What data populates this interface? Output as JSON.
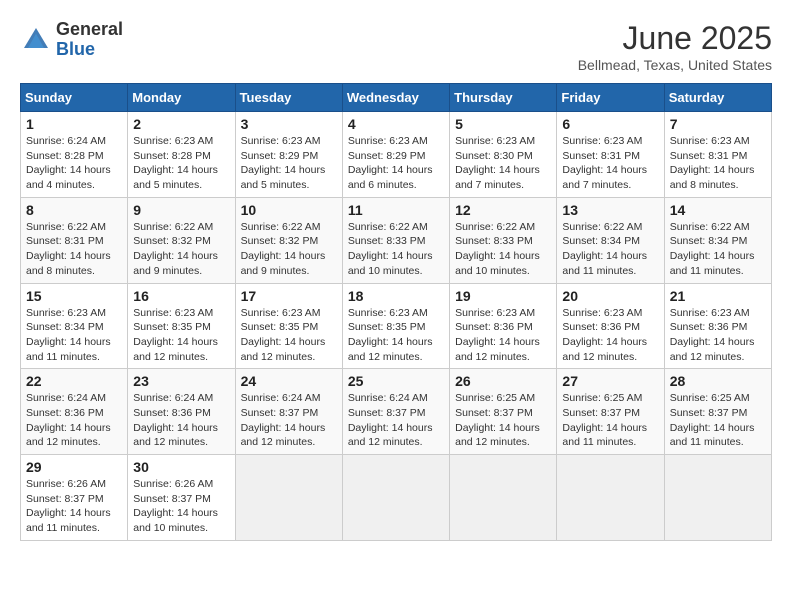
{
  "logo": {
    "general": "General",
    "blue": "Blue"
  },
  "title": "June 2025",
  "location": "Bellmead, Texas, United States",
  "days_of_week": [
    "Sunday",
    "Monday",
    "Tuesday",
    "Wednesday",
    "Thursday",
    "Friday",
    "Saturday"
  ],
  "weeks": [
    [
      {
        "day": "1",
        "sunrise": "6:24 AM",
        "sunset": "8:28 PM",
        "daylight": "14 hours and 4 minutes."
      },
      {
        "day": "2",
        "sunrise": "6:23 AM",
        "sunset": "8:28 PM",
        "daylight": "14 hours and 5 minutes."
      },
      {
        "day": "3",
        "sunrise": "6:23 AM",
        "sunset": "8:29 PM",
        "daylight": "14 hours and 5 minutes."
      },
      {
        "day": "4",
        "sunrise": "6:23 AM",
        "sunset": "8:29 PM",
        "daylight": "14 hours and 6 minutes."
      },
      {
        "day": "5",
        "sunrise": "6:23 AM",
        "sunset": "8:30 PM",
        "daylight": "14 hours and 7 minutes."
      },
      {
        "day": "6",
        "sunrise": "6:23 AM",
        "sunset": "8:31 PM",
        "daylight": "14 hours and 7 minutes."
      },
      {
        "day": "7",
        "sunrise": "6:23 AM",
        "sunset": "8:31 PM",
        "daylight": "14 hours and 8 minutes."
      }
    ],
    [
      {
        "day": "8",
        "sunrise": "6:22 AM",
        "sunset": "8:31 PM",
        "daylight": "14 hours and 8 minutes."
      },
      {
        "day": "9",
        "sunrise": "6:22 AM",
        "sunset": "8:32 PM",
        "daylight": "14 hours and 9 minutes."
      },
      {
        "day": "10",
        "sunrise": "6:22 AM",
        "sunset": "8:32 PM",
        "daylight": "14 hours and 9 minutes."
      },
      {
        "day": "11",
        "sunrise": "6:22 AM",
        "sunset": "8:33 PM",
        "daylight": "14 hours and 10 minutes."
      },
      {
        "day": "12",
        "sunrise": "6:22 AM",
        "sunset": "8:33 PM",
        "daylight": "14 hours and 10 minutes."
      },
      {
        "day": "13",
        "sunrise": "6:22 AM",
        "sunset": "8:34 PM",
        "daylight": "14 hours and 11 minutes."
      },
      {
        "day": "14",
        "sunrise": "6:22 AM",
        "sunset": "8:34 PM",
        "daylight": "14 hours and 11 minutes."
      }
    ],
    [
      {
        "day": "15",
        "sunrise": "6:23 AM",
        "sunset": "8:34 PM",
        "daylight": "14 hours and 11 minutes."
      },
      {
        "day": "16",
        "sunrise": "6:23 AM",
        "sunset": "8:35 PM",
        "daylight": "14 hours and 12 minutes."
      },
      {
        "day": "17",
        "sunrise": "6:23 AM",
        "sunset": "8:35 PM",
        "daylight": "14 hours and 12 minutes."
      },
      {
        "day": "18",
        "sunrise": "6:23 AM",
        "sunset": "8:35 PM",
        "daylight": "14 hours and 12 minutes."
      },
      {
        "day": "19",
        "sunrise": "6:23 AM",
        "sunset": "8:36 PM",
        "daylight": "14 hours and 12 minutes."
      },
      {
        "day": "20",
        "sunrise": "6:23 AM",
        "sunset": "8:36 PM",
        "daylight": "14 hours and 12 minutes."
      },
      {
        "day": "21",
        "sunrise": "6:23 AM",
        "sunset": "8:36 PM",
        "daylight": "14 hours and 12 minutes."
      }
    ],
    [
      {
        "day": "22",
        "sunrise": "6:24 AM",
        "sunset": "8:36 PM",
        "daylight": "14 hours and 12 minutes."
      },
      {
        "day": "23",
        "sunrise": "6:24 AM",
        "sunset": "8:36 PM",
        "daylight": "14 hours and 12 minutes."
      },
      {
        "day": "24",
        "sunrise": "6:24 AM",
        "sunset": "8:37 PM",
        "daylight": "14 hours and 12 minutes."
      },
      {
        "day": "25",
        "sunrise": "6:24 AM",
        "sunset": "8:37 PM",
        "daylight": "14 hours and 12 minutes."
      },
      {
        "day": "26",
        "sunrise": "6:25 AM",
        "sunset": "8:37 PM",
        "daylight": "14 hours and 12 minutes."
      },
      {
        "day": "27",
        "sunrise": "6:25 AM",
        "sunset": "8:37 PM",
        "daylight": "14 hours and 11 minutes."
      },
      {
        "day": "28",
        "sunrise": "6:25 AM",
        "sunset": "8:37 PM",
        "daylight": "14 hours and 11 minutes."
      }
    ],
    [
      {
        "day": "29",
        "sunrise": "6:26 AM",
        "sunset": "8:37 PM",
        "daylight": "14 hours and 11 minutes."
      },
      {
        "day": "30",
        "sunrise": "6:26 AM",
        "sunset": "8:37 PM",
        "daylight": "14 hours and 10 minutes."
      },
      null,
      null,
      null,
      null,
      null
    ]
  ]
}
